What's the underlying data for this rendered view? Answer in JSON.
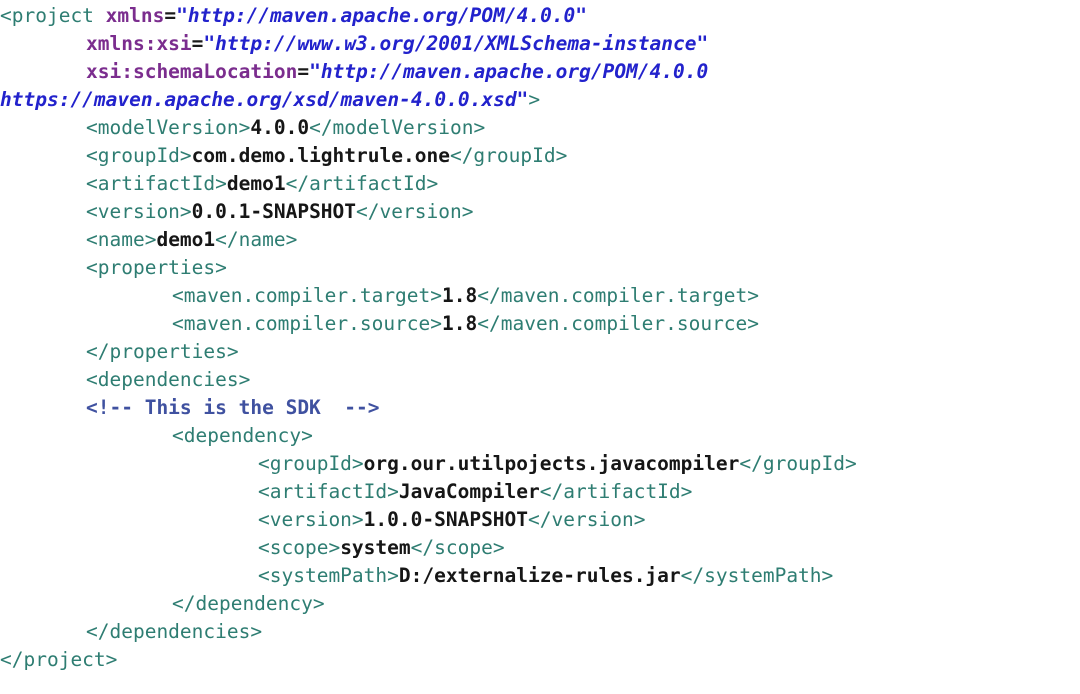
{
  "editor": {
    "language": "xml",
    "file_kind": "maven-pom",
    "background": "#ffffff",
    "colors": {
      "tag": "#2e7d72",
      "attribute_name": "#7b2d8e",
      "attribute_value": "#2222cc",
      "text_content": "#161616",
      "comment": "#3f51a0"
    }
  },
  "code": {
    "lines": [
      {
        "indent": 0,
        "tokens": [
          {
            "type": "tag",
            "text": "<project "
          },
          {
            "type": "attr",
            "text": "xmlns"
          },
          {
            "type": "eq",
            "text": "="
          },
          {
            "type": "val",
            "text": "\"http://maven.apache.org/POM/4.0.0\""
          }
        ]
      },
      {
        "indent": 1,
        "tokens": [
          {
            "type": "attr",
            "text": "xmlns:xsi"
          },
          {
            "type": "eq",
            "text": "="
          },
          {
            "type": "val",
            "text": "\"http://www.w3.org/2001/XMLSchema-instance\""
          }
        ]
      },
      {
        "indent": 1,
        "tokens": [
          {
            "type": "attr",
            "text": "xsi:schemaLocation"
          },
          {
            "type": "eq",
            "text": "="
          },
          {
            "type": "val",
            "text": "\"http://maven.apache.org/POM/4.0.0"
          }
        ]
      },
      {
        "indent": 0,
        "tokens": [
          {
            "type": "val",
            "text": "https://maven.apache.org/xsd/maven-4.0.0.xsd\""
          },
          {
            "type": "tag",
            "text": ">"
          }
        ]
      },
      {
        "indent": 1,
        "tokens": [
          {
            "type": "tag",
            "text": "<modelVersion>"
          },
          {
            "type": "txt",
            "text": "4.0.0"
          },
          {
            "type": "tag",
            "text": "</modelVersion>"
          }
        ]
      },
      {
        "indent": 1,
        "tokens": [
          {
            "type": "tag",
            "text": "<groupId>"
          },
          {
            "type": "txt",
            "text": "com.demo.lightrule.one"
          },
          {
            "type": "tag",
            "text": "</groupId>"
          }
        ]
      },
      {
        "indent": 1,
        "tokens": [
          {
            "type": "tag",
            "text": "<artifactId>"
          },
          {
            "type": "txt",
            "text": "demo1"
          },
          {
            "type": "tag",
            "text": "</artifactId>"
          }
        ]
      },
      {
        "indent": 1,
        "tokens": [
          {
            "type": "tag",
            "text": "<version>"
          },
          {
            "type": "txt",
            "text": "0.0.1-SNAPSHOT"
          },
          {
            "type": "tag",
            "text": "</version>"
          }
        ]
      },
      {
        "indent": 1,
        "tokens": [
          {
            "type": "tag",
            "text": "<name>"
          },
          {
            "type": "txt",
            "text": "demo1"
          },
          {
            "type": "tag",
            "text": "</name>"
          }
        ]
      },
      {
        "indent": 1,
        "tokens": [
          {
            "type": "tag",
            "text": "<properties>"
          }
        ]
      },
      {
        "indent": 2,
        "tokens": [
          {
            "type": "tag",
            "text": "<maven.compiler.target>"
          },
          {
            "type": "txt",
            "text": "1.8"
          },
          {
            "type": "tag",
            "text": "</maven.compiler.target>"
          }
        ]
      },
      {
        "indent": 2,
        "tokens": [
          {
            "type": "tag",
            "text": "<maven.compiler.source>"
          },
          {
            "type": "txt",
            "text": "1.8"
          },
          {
            "type": "tag",
            "text": "</maven.compiler.source>"
          }
        ]
      },
      {
        "indent": 1,
        "tokens": [
          {
            "type": "tag",
            "text": "</properties>"
          }
        ]
      },
      {
        "indent": 1,
        "tokens": [
          {
            "type": "tag",
            "text": "<dependencies>"
          }
        ]
      },
      {
        "indent": 1,
        "tokens": [
          {
            "type": "comment",
            "text": "<!-- This is the SDK  -->"
          }
        ]
      },
      {
        "indent": 2,
        "tokens": [
          {
            "type": "tag",
            "text": "<dependency>"
          }
        ]
      },
      {
        "indent": 3,
        "tokens": [
          {
            "type": "tag",
            "text": "<groupId>"
          },
          {
            "type": "txt",
            "text": "org.our.utilpojects.javacompiler"
          },
          {
            "type": "tag",
            "text": "</groupId>"
          }
        ]
      },
      {
        "indent": 3,
        "tokens": [
          {
            "type": "tag",
            "text": "<artifactId>"
          },
          {
            "type": "txt",
            "text": "JavaCompiler"
          },
          {
            "type": "tag",
            "text": "</artifactId>"
          }
        ]
      },
      {
        "indent": 3,
        "tokens": [
          {
            "type": "tag",
            "text": "<version>"
          },
          {
            "type": "txt",
            "text": "1.0.0-SNAPSHOT"
          },
          {
            "type": "tag",
            "text": "</version>"
          }
        ]
      },
      {
        "indent": 3,
        "tokens": [
          {
            "type": "tag",
            "text": "<scope>"
          },
          {
            "type": "txt",
            "text": "system"
          },
          {
            "type": "tag",
            "text": "</scope>"
          }
        ]
      },
      {
        "indent": 3,
        "tokens": [
          {
            "type": "tag",
            "text": "<systemPath>"
          },
          {
            "type": "txt",
            "text": "D:/externalize-rules.jar"
          },
          {
            "type": "tag",
            "text": "</systemPath>"
          }
        ]
      },
      {
        "indent": 2,
        "tokens": [
          {
            "type": "tag",
            "text": "</dependency>"
          }
        ]
      },
      {
        "indent": 1,
        "tokens": [
          {
            "type": "tag",
            "text": "</dependencies>"
          }
        ]
      },
      {
        "indent": 0,
        "tokens": [
          {
            "type": "tag",
            "text": "</project>"
          }
        ]
      }
    ]
  }
}
